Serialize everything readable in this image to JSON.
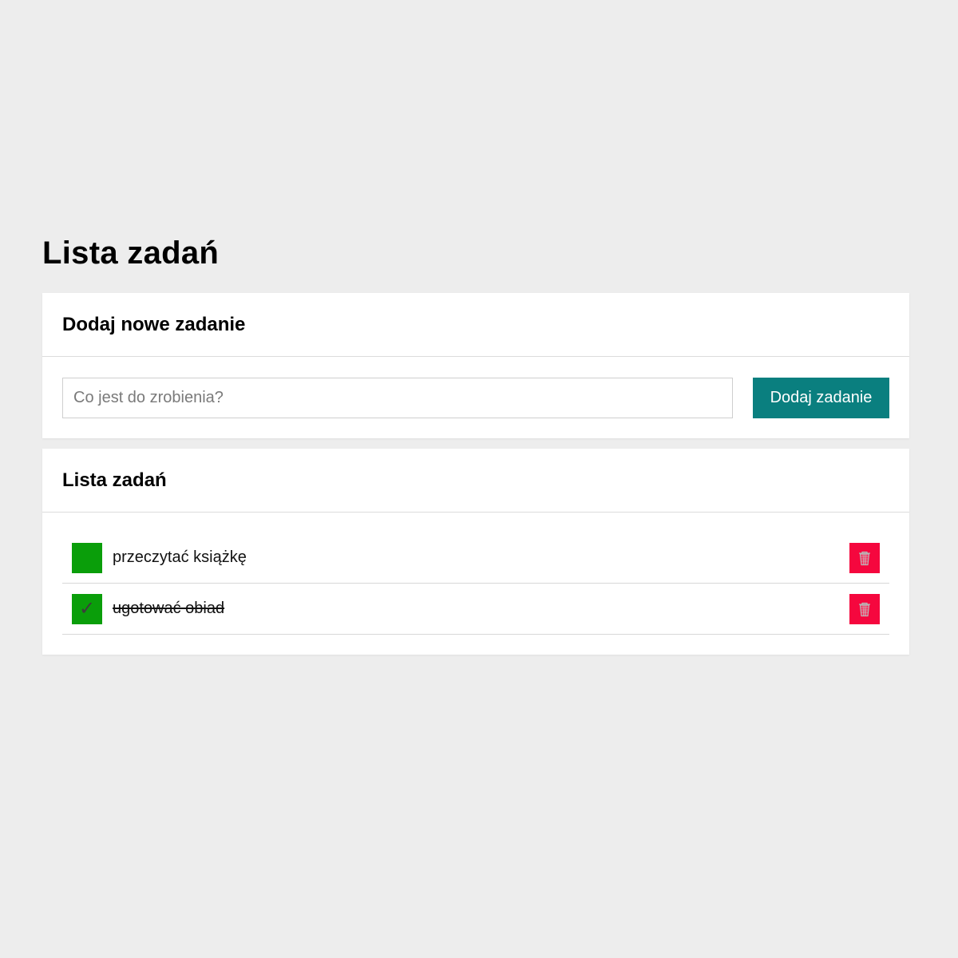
{
  "page": {
    "title": "Lista zadań"
  },
  "add_section": {
    "heading": "Dodaj nowe zadanie",
    "input_value": "",
    "input_placeholder": "Co jest do zrobienia?",
    "button_label": "Dodaj zadanie"
  },
  "list_section": {
    "heading": "Lista zadań",
    "tasks": [
      {
        "text": "przeczytać książkę",
        "done": false,
        "check_glyph": ""
      },
      {
        "text": "ugotować obiad",
        "done": true,
        "check_glyph": "✓"
      }
    ]
  },
  "icons": {
    "delete": "trash-icon",
    "check": "checkmark-icon"
  },
  "colors": {
    "background": "#ededed",
    "card": "#ffffff",
    "accent_button": "#0a7f7f",
    "checkbox": "#0a9e0a",
    "delete": "#f5073e"
  }
}
